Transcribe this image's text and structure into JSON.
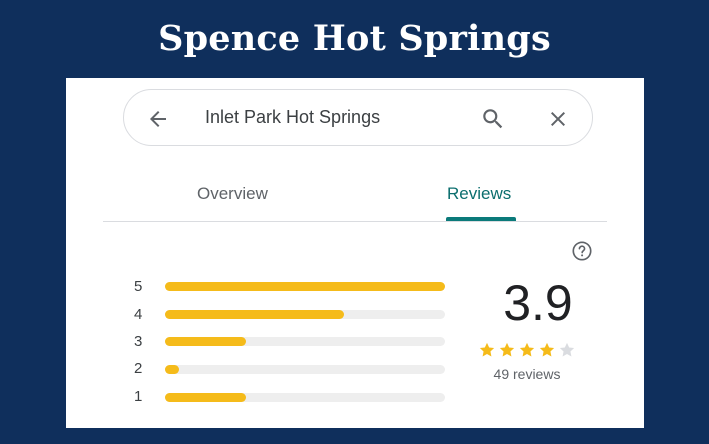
{
  "headline": "Spence Hot Springs",
  "search": {
    "query": "Inlet Park Hot Springs",
    "back_icon": "arrow-left-icon",
    "search_icon": "search-icon",
    "close_icon": "close-icon"
  },
  "tabs": [
    {
      "label": "Overview",
      "active": false
    },
    {
      "label": "Reviews",
      "active": true
    }
  ],
  "help_icon": "question-circle-icon",
  "rating_breakdown": [
    {
      "stars": "5",
      "fraction": 1.0
    },
    {
      "stars": "4",
      "fraction": 0.64
    },
    {
      "stars": "3",
      "fraction": 0.29
    },
    {
      "stars": "2",
      "fraction": 0.05
    },
    {
      "stars": "1",
      "fraction": 0.29
    }
  ],
  "rating": {
    "score": "3.9",
    "filled_stars": 4,
    "total_stars": 5,
    "review_count": "49 reviews"
  },
  "colors": {
    "background": "#0f2f5c",
    "bar_fill": "#f5bb1a",
    "bar_track": "#eeeeee",
    "star_filled": "#f5bb1a",
    "star_empty": "#dadce0",
    "active_tab": "#0b7a7a"
  }
}
